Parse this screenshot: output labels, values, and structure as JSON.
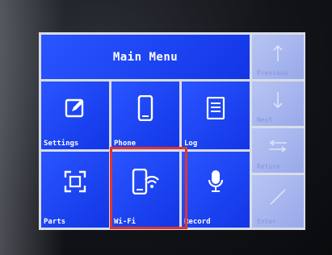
{
  "main_menu": {
    "title": "Main Menu",
    "tiles": [
      {
        "label": "Settings",
        "icon": "edit-icon"
      },
      {
        "label": "Phone",
        "icon": "phone-icon"
      },
      {
        "label": "Log",
        "icon": "log-icon"
      },
      {
        "label": "Parts",
        "icon": "parts-icon"
      },
      {
        "label": "Wi-Fi",
        "icon": "wifi-phone-icon"
      },
      {
        "label": "Record",
        "icon": "microphone-icon"
      }
    ]
  },
  "side_keys": [
    {
      "label": "Previous",
      "icon": "arrow-up-icon"
    },
    {
      "label": "Next",
      "icon": "arrow-down-icon"
    },
    {
      "label": "Return",
      "icon": "return-icon"
    },
    {
      "label": "Enter",
      "icon": "enter-icon"
    }
  ],
  "colors": {
    "tile": "#1f47f5",
    "side_key": "#a8b6ef",
    "highlight": "#e0352c"
  }
}
